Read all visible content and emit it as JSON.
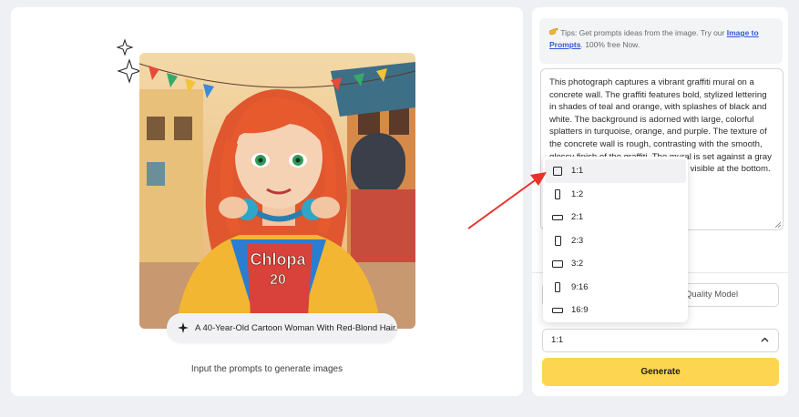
{
  "canvas": {
    "illustration": "anime-style illustration of a red-haired woman wearing headphones in a colorful street",
    "prompt_chip": "A 40-Year-Old Cartoon Woman With Red-Blond Hair...",
    "helper_text": "Input the prompts to generate images"
  },
  "sidebar": {
    "tips": {
      "icon": "pointing-hand-icon",
      "prefix": "Tips: Get prompts ideas from the image. Try our ",
      "link": "Image to Prompts",
      "suffix": ". 100% free Now."
    },
    "prompt_text": "This photograph captures a vibrant graffiti mural on a concrete wall. The graffiti features bold, stylized lettering in shades of teal and orange, with splashes of black and white. The background is adorned with large, colorful splatters in turquoise, orange, and purple. The texture of the concrete wall is rough, contrasting with the smooth, glossy finish of the graffiti. The mural is set against a gray urban backdrop with a strip of grass visible at the bottom.",
    "model_label": "Quality Model",
    "aspect_ratio": "1:1",
    "generate_label": "Generate"
  },
  "ratio_dropdown": {
    "selected": "1:1",
    "options": [
      "1:1",
      "1:2",
      "2:1",
      "2:3",
      "3:2",
      "9:16",
      "16:9"
    ]
  },
  "colors": {
    "accent": "#fdd550",
    "link": "#2f5bd8",
    "annotation_arrow": "#e8322b"
  }
}
